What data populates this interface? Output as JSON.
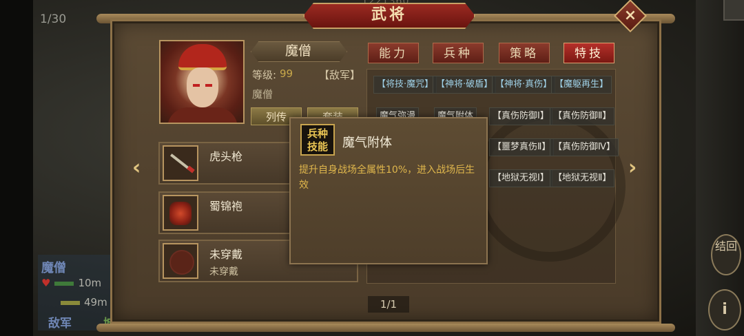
{
  "window": {
    "title": "武将",
    "close_label": "×"
  },
  "background": {
    "page_counter": "1/30",
    "top_partial_text": "1221360",
    "unit_name": "魔僧",
    "unit_hp": "10m",
    "unit_troops": "49m",
    "side_enemy": "敌军",
    "side_other": "城",
    "right_button_1": "结回",
    "right_button_2": "i"
  },
  "hero": {
    "name": "魔僧",
    "level_label": "等级:",
    "level_value": "99",
    "faction": "【敌军】",
    "subtitle": "魔僧",
    "bio_button": "列传",
    "set_button": "套装"
  },
  "equipment": [
    {
      "name": "虎头枪",
      "sub": ""
    },
    {
      "name": "蜀锦袍",
      "sub": ""
    },
    {
      "name": "未穿戴",
      "sub": "未穿戴"
    }
  ],
  "tabs": [
    "能力",
    "兵种",
    "策略",
    "特技"
  ],
  "active_tab": "特技",
  "skills": {
    "row1": [
      "【将技·魔咒】",
      "【神将·破盾】",
      "【神将·真伤】",
      "【魔躯再生】"
    ],
    "row2": [
      "魔气弥漫",
      "魔气附体",
      "【真伤防御Ⅰ】",
      "【真伤防御Ⅱ】"
    ],
    "row3": [
      "【噩梦真伤Ⅱ】",
      "【真伤防御Ⅳ】"
    ],
    "row4": [
      "【地狱无视Ⅰ】",
      "【地狱无视Ⅱ】"
    ]
  },
  "pager": "1/1",
  "tooltip": {
    "badge": "兵种技能",
    "badge_line1": "兵种",
    "badge_line2": "技能",
    "title": "魔气附体",
    "description": "提升自身战场全属性10%，进入战场后生效"
  },
  "nav": {
    "prev": "‹",
    "next": "›"
  }
}
